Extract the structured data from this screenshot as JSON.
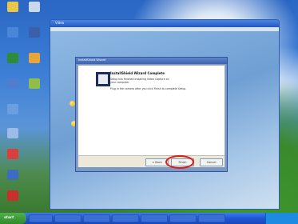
{
  "desktop": {
    "icons": [
      {
        "label": "",
        "color": "#e8c64a"
      },
      {
        "label": "",
        "color": "#c9d8ec"
      },
      {
        "label": "",
        "color": "#4a86d8"
      },
      {
        "label": "",
        "color": "#3b5fa8"
      },
      {
        "label": "",
        "color": "#2e8b3a"
      },
      {
        "label": "",
        "color": "#e8a53a"
      },
      {
        "label": "",
        "color": "#4f7ecf"
      },
      {
        "label": "",
        "color": "#8fbf4a"
      },
      {
        "label": "",
        "color": "#6aa0e0"
      },
      {
        "label": "",
        "color": "#9cbbe6"
      },
      {
        "label": "",
        "color": "#d84040"
      },
      {
        "label": "",
        "color": "#3e6cc0"
      },
      {
        "label": "",
        "color": "#c83030"
      }
    ]
  },
  "background_window": {
    "title": "Video",
    "menu": [
      "File",
      "Edit",
      "Control",
      "Help"
    ]
  },
  "wizard": {
    "title": "InstallShield Wizard",
    "heading": "InstallShield Wizard Complete",
    "line1": "Setup has finished installing Video Capture on",
    "line2": "your computer.",
    "line3": "Plug in the camera after you click Finish to complete Setup.",
    "buttons": {
      "back": "< Back",
      "finish": "Finish",
      "cancel": "Cancel"
    }
  },
  "taskbar": {
    "start_label": "start",
    "items": [
      "",
      "",
      "",
      "",
      "",
      "",
      ""
    ],
    "clock": ""
  },
  "colors": {
    "highlight": "#e01818",
    "taskbar": "#1f55d4",
    "start": "#2f8a2b"
  }
}
